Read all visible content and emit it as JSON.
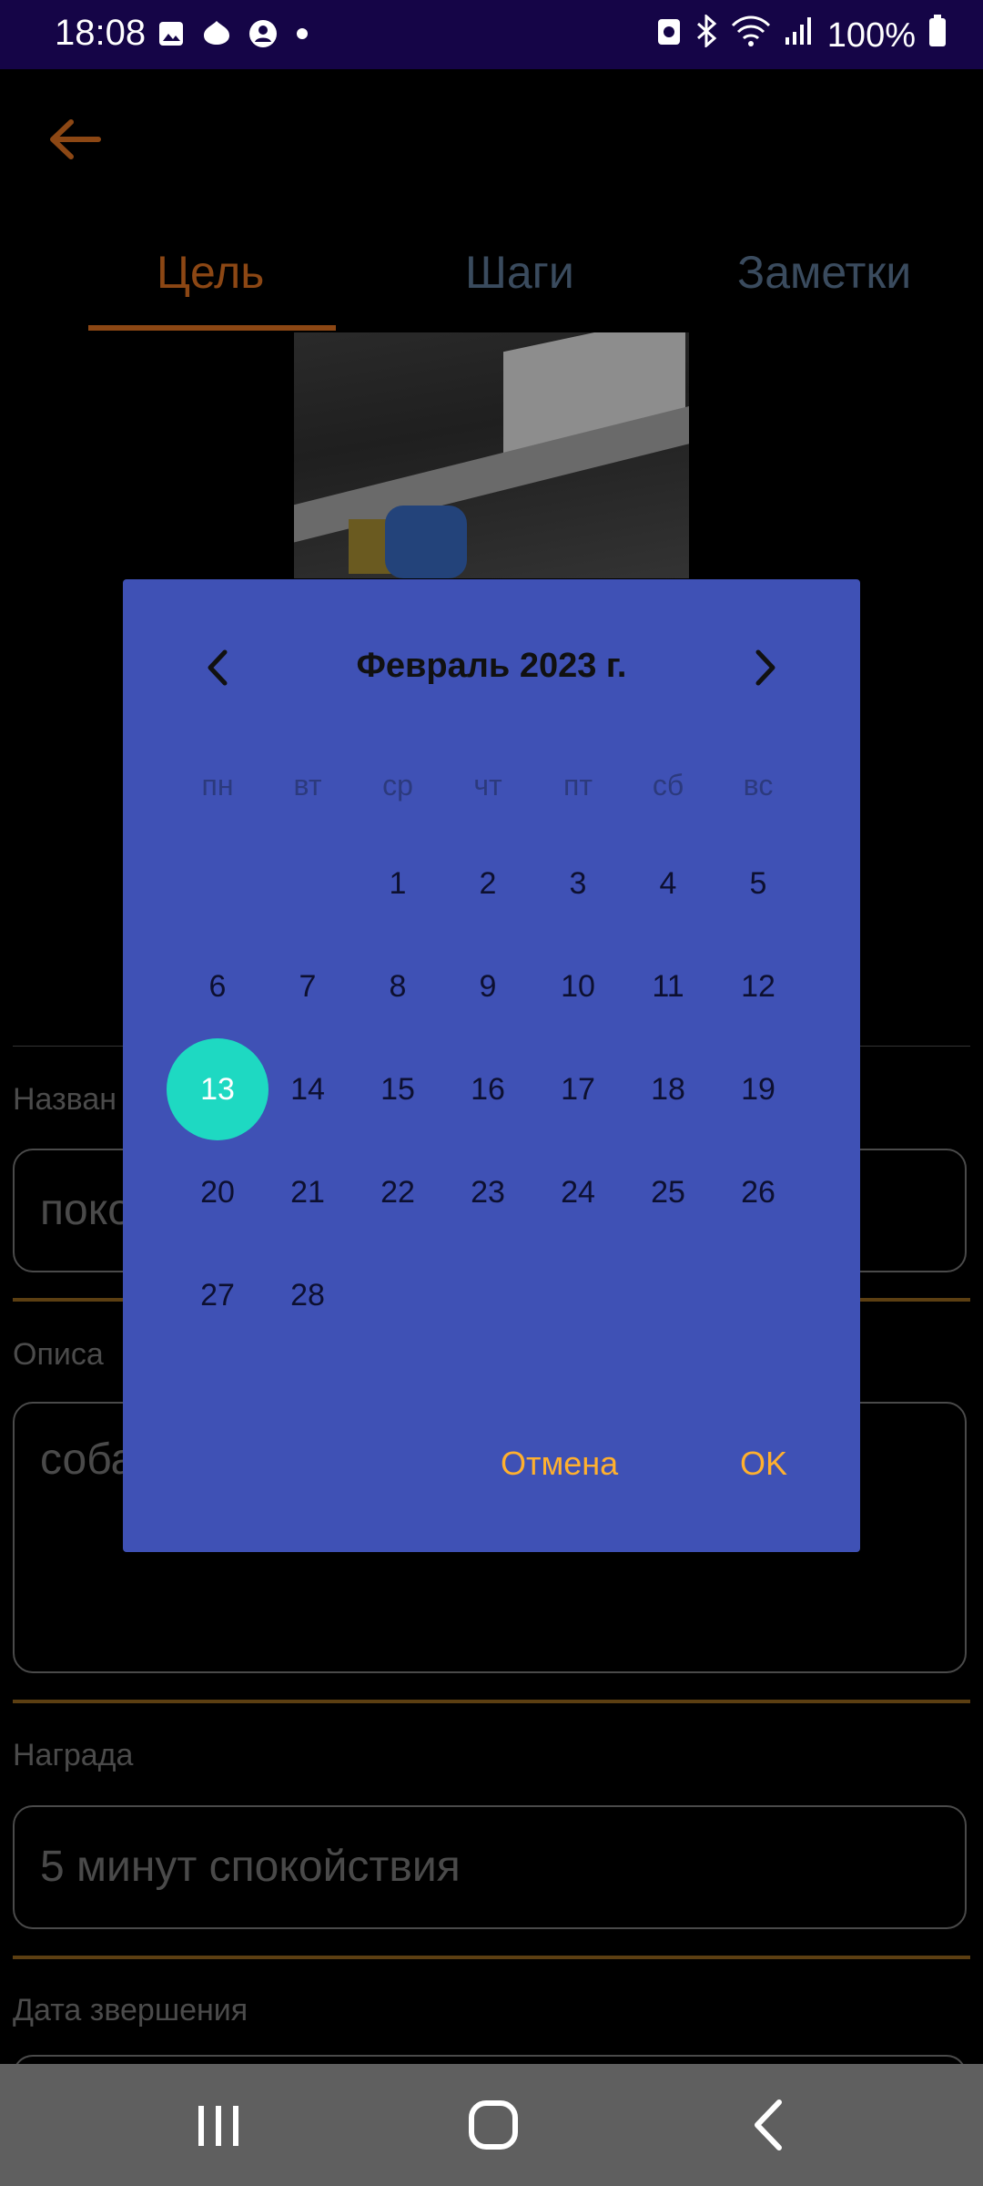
{
  "status_bar": {
    "time": "18:08",
    "battery": "100%",
    "icons_left": [
      "image-icon",
      "leaf-icon",
      "account-icon",
      "dot-icon"
    ],
    "icons_right": [
      "clipboard-icon",
      "bluetooth-icon",
      "wifi-icon",
      "signal-icon",
      "battery-icon"
    ]
  },
  "app": {
    "tabs": [
      "Цель",
      "Шаги",
      "Заметки"
    ],
    "active_tab": 0,
    "fields": {
      "name_label": "Назван",
      "name_value": "поко",
      "description_label": "Описа",
      "description_value": "соба",
      "reward_label": "Награда",
      "reward_value": "5 минут спокойствия",
      "date_label": "Дата звершения"
    }
  },
  "date_picker": {
    "month_title": "Февраль 2023 г.",
    "weekdays": [
      "пн",
      "вт",
      "ср",
      "чт",
      "пт",
      "сб",
      "вс"
    ],
    "days": [
      "1",
      "2",
      "3",
      "4",
      "5",
      "6",
      "7",
      "8",
      "9",
      "10",
      "11",
      "12",
      "13",
      "14",
      "15",
      "16",
      "17",
      "18",
      "19",
      "20",
      "21",
      "22",
      "23",
      "24",
      "25",
      "26",
      "27",
      "28"
    ],
    "first_weekday_index": 2,
    "selected_day": "13",
    "cancel_label": "Отмена",
    "ok_label": "OK",
    "colors": {
      "dialog_bg": "#3f51b5",
      "selected": "#1ed9c2",
      "button_text": "#ffb02e"
    }
  },
  "nav_bar": {
    "buttons": [
      "recents-icon",
      "home-icon",
      "back-icon"
    ]
  }
}
